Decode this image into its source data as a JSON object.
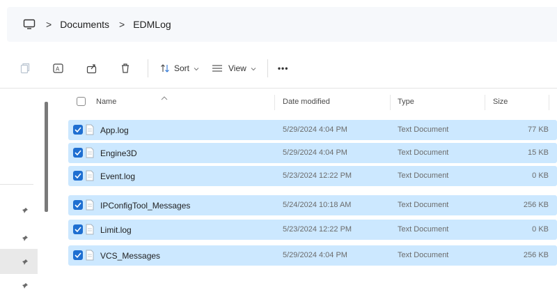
{
  "address_bar": {
    "icon": "computer-icon",
    "separator": ">",
    "crumbs": [
      "Documents",
      "EDMLog"
    ]
  },
  "toolbar": {
    "icons": [
      "copy-icon",
      "rename-icon",
      "share-icon",
      "delete-icon"
    ],
    "sort_label": "Sort",
    "view_label": "View",
    "more_label": "•••"
  },
  "table": {
    "columns": [
      "Name",
      "Date modified",
      "Type",
      "Size"
    ],
    "rows": [
      {
        "name": "App.log",
        "date": "5/29/2024 4:04 PM",
        "type": "Text Document",
        "size": "77 KB",
        "selected": true
      },
      {
        "name": "Engine3D",
        "date": "5/29/2024 4:04 PM",
        "type": "Text Document",
        "size": "15 KB",
        "selected": true
      },
      {
        "name": "Event.log",
        "date": "5/23/2024 12:22 PM",
        "type": "Text Document",
        "size": "0 KB",
        "selected": true
      },
      {
        "name": "IPConfigTool_Messages",
        "date": "5/24/2024 10:18 AM",
        "type": "Text Document",
        "size": "256 KB",
        "selected": true
      },
      {
        "name": "Limit.log",
        "date": "5/23/2024 12:22 PM",
        "type": "Text Document",
        "size": "0 KB",
        "selected": true
      },
      {
        "name": "VCS_Messages",
        "date": "5/29/2024 4:04 PM",
        "type": "Text Document",
        "size": "256 KB",
        "selected": true
      }
    ]
  },
  "colors": {
    "selection": "#cce8ff",
    "checkbox": "#1f6fd1",
    "address_bg": "#f6f8fb"
  }
}
